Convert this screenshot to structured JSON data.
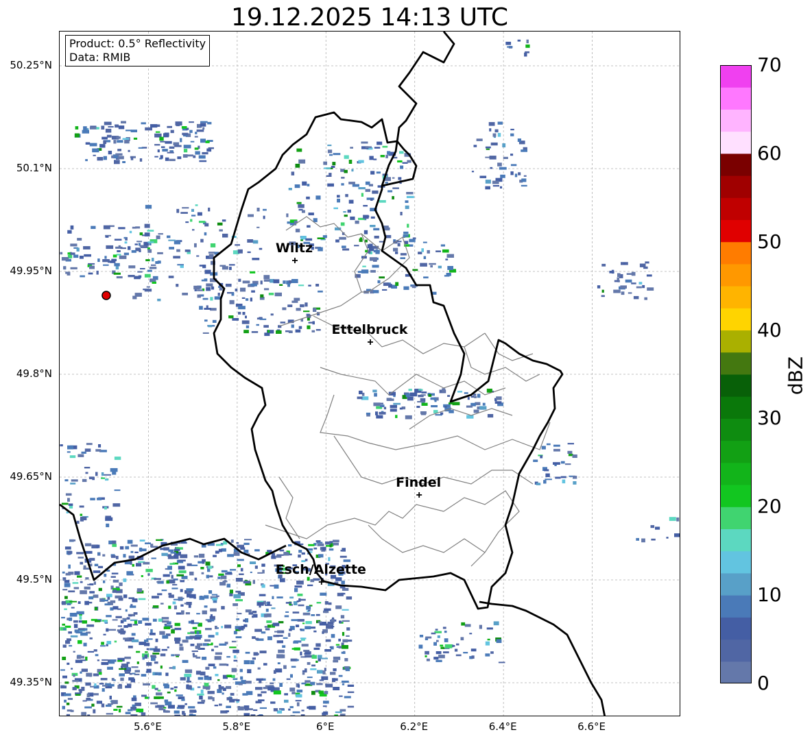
{
  "title": "19.12.2025 14:13 UTC",
  "info_box": {
    "product": "Product: 0.5° Reflectivity",
    "data": "Data: RMIB"
  },
  "axes": {
    "lon_range": [
      5.4,
      6.8
    ],
    "lat_range": [
      49.3,
      50.3
    ],
    "lat_ticks": [
      "49.35°N",
      "49.5°N",
      "49.65°N",
      "49.8°N",
      "49.95°N",
      "50.1°N",
      "50.25°N"
    ],
    "lat_tick_values": [
      49.35,
      49.5,
      49.65,
      49.8,
      49.95,
      50.1,
      50.25
    ],
    "lon_ticks": [
      "5.6°E",
      "5.8°E",
      "6°E",
      "6.2°E",
      "6.4°E",
      "6.6°E"
    ],
    "lon_tick_values": [
      5.6,
      5.8,
      6.0,
      6.2,
      6.4,
      6.6
    ],
    "grid": true
  },
  "cities": [
    {
      "name": "Wiltz",
      "lon": 5.93,
      "lat": 49.966
    },
    {
      "name": "Ettelbruck",
      "lon": 6.1,
      "lat": 49.847
    },
    {
      "name": "Findel",
      "lon": 6.21,
      "lat": 49.624
    },
    {
      "name": "Esch/Alzette",
      "lon": 5.99,
      "lat": 49.497
    }
  ],
  "radar_site": {
    "lon": 5.505,
    "lat": 49.915,
    "color": "#e00000"
  },
  "colorbar": {
    "label": "dBZ",
    "min": 0,
    "max": 70,
    "tick_labels": [
      "0",
      "10",
      "20",
      "30",
      "40",
      "50",
      "60",
      "70"
    ],
    "colors": [
      "#6478aa",
      "#5066a4",
      "#445ea4",
      "#4a7ab8",
      "#58a0c8",
      "#62c4e0",
      "#5cd8c0",
      "#40d470",
      "#12c620",
      "#12b41a",
      "#12a014",
      "#0e8c10",
      "#0a780a",
      "#086008",
      "#447810",
      "#aab000",
      "#ffd400",
      "#ffb400",
      "#ff9800",
      "#ff7c00",
      "#e00000",
      "#c00000",
      "#a00000",
      "#7a0000",
      "#ffe0ff",
      "#ffb4ff",
      "#ff78ff",
      "#f040f0"
    ]
  }
}
